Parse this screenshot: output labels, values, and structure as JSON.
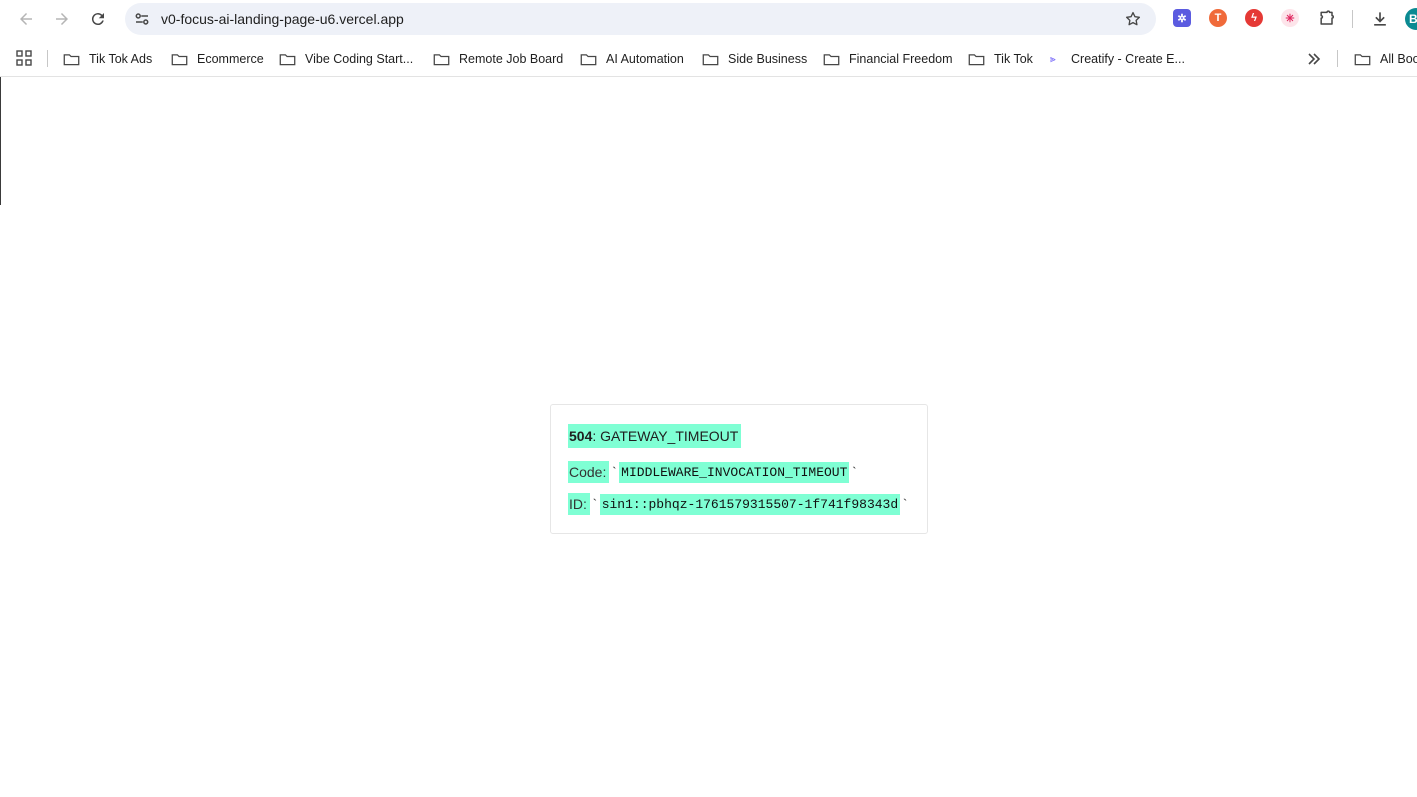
{
  "browser": {
    "url": "v0-focus-ai-landing-page-u6.vercel.app",
    "avatar_initial": "B"
  },
  "bookmarks": [
    {
      "label": "Tik Tok Ads"
    },
    {
      "label": "Ecommerce"
    },
    {
      "label": "Vibe Coding Start..."
    },
    {
      "label": "Remote Job Board"
    },
    {
      "label": "AI Automation"
    },
    {
      "label": "Side Business"
    },
    {
      "label": "Financial Freedom"
    },
    {
      "label": "Tik Tok"
    },
    {
      "label": "Creatify - Create E..."
    }
  ],
  "all_bookmarks_label": "All Boo",
  "error": {
    "status_code": "504",
    "status_text": ": GATEWAY_TIMEOUT",
    "code_label": "Code: ",
    "code_value": "MIDDLEWARE_INVOCATION_TIMEOUT",
    "id_label": "ID: ",
    "id_value": "sin1::pbhqz-1761579315507-1f741f98343d",
    "backtick": "`"
  },
  "colors": {
    "highlight": "#7fffd4",
    "omnibox_bg": "#eef1f8",
    "avatar_bg": "#0b8a92"
  }
}
